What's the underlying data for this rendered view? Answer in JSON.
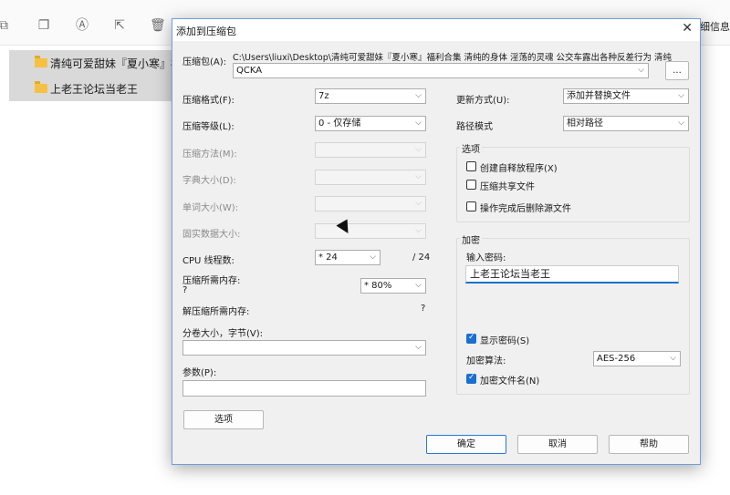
{
  "explorer": {
    "details_label": "详细信息",
    "files": [
      {
        "name": "清纯可爱甜妹『夏小寒』福利合集"
      },
      {
        "name": "上老王论坛当老王"
      }
    ]
  },
  "dialog": {
    "title": "添加到压缩包",
    "archive_label": "压缩包(A):",
    "archive_path": "C:\\Users\\liuxi\\Desktop\\清纯可爱甜妹『夏小寒』福利合集 清纯的身体 淫荡的灵魂 公交车露出各种反差行为 清纯",
    "archive_name": "QCKA",
    "browse_label": "...",
    "left": {
      "format_label": "压缩格式(F):",
      "format_value": "7z",
      "level_label": "压缩等级(L):",
      "level_value": "0 - 仅存储",
      "method_label": "压缩方法(M):",
      "dict_label": "字典大小(D):",
      "word_label": "单词大小(W):",
      "solid_label": "固实数据大小:",
      "cpu_label": "CPU 线程数:",
      "cpu_value": "* 24",
      "cpu_total": "/ 24",
      "mem_label": "压缩所需内存:",
      "mem_q": "?",
      "mem_value": "* 80%",
      "decomp_label": "解压缩所需内存:",
      "decomp_q": "?",
      "volume_label": "分卷大小，字节(V):",
      "params_label": "参数(P):",
      "options_button": "选项"
    },
    "right": {
      "update_label": "更新方式(U):",
      "update_value": "添加并替换文件",
      "path_label": "路径模式",
      "path_value": "相对路径",
      "options_group": "选项",
      "opt_sfx": "创建自释放程序(X)",
      "opt_shared": "压缩共享文件",
      "opt_delete": "操作完成后删除源文件",
      "encrypt_group": "加密",
      "password_label": "输入密码:",
      "password_value": "上老王论坛当老王",
      "show_password": "显示密码(S)",
      "algo_label": "加密算法:",
      "algo_value": "AES-256",
      "encrypt_names": "加密文件名(N)"
    },
    "buttons": {
      "ok": "确定",
      "cancel": "取消",
      "help": "帮助"
    }
  },
  "colors": {
    "accent": "#1a6fd1",
    "dialog_bg": "#f0f0f0"
  }
}
